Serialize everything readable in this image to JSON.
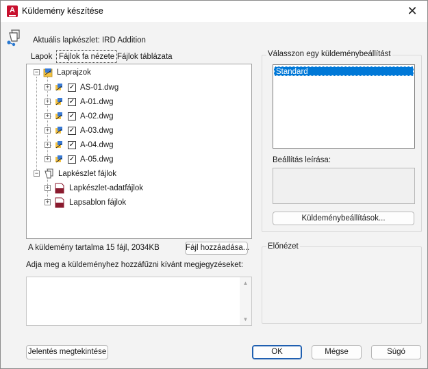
{
  "window": {
    "title": "Küldemény készítése",
    "close_glyph": "✕",
    "app_icon": "autocad-icon",
    "app_icon_letter": "A"
  },
  "current_sheet_set": "Aktuális lapkészlet: IRD Addition",
  "tabs": [
    {
      "label": "Lapok",
      "active": false
    },
    {
      "label": "Fájlok fa nézete",
      "active": true
    },
    {
      "label": "Fájlok táblázata",
      "active": false
    }
  ],
  "tree": {
    "root_drawings": {
      "label": "Laprajzok",
      "expander": "−",
      "icon": "drawings-folder-icon"
    },
    "drawings": [
      {
        "label": "AS-01.dwg",
        "checked": true,
        "expander": "+",
        "icon": "dwg-file-icon"
      },
      {
        "label": "A-01.dwg",
        "checked": true,
        "expander": "+",
        "icon": "dwg-file-icon"
      },
      {
        "label": "A-02.dwg",
        "checked": true,
        "expander": "+",
        "icon": "dwg-file-icon"
      },
      {
        "label": "A-03.dwg",
        "checked": true,
        "expander": "+",
        "icon": "dwg-file-icon"
      },
      {
        "label": "A-04.dwg",
        "checked": true,
        "expander": "+",
        "icon": "dwg-file-icon"
      },
      {
        "label": "A-05.dwg",
        "checked": true,
        "expander": "+",
        "icon": "dwg-file-icon"
      }
    ],
    "root_sheetset": {
      "label": "Lapkészlet fájlok",
      "expander": "−",
      "icon": "sheetset-file-icon"
    },
    "sheetset_files": [
      {
        "label": "Lapkészlet-adatfájlok",
        "expander": "+",
        "icon": "dst-file-icon",
        "badge": "DST"
      },
      {
        "label": "Lapsablon fájlok",
        "expander": "+",
        "icon": "dwt-file-icon",
        "badge": "DWT"
      }
    ],
    "check_glyph": "✓"
  },
  "summary": "A küldemény tartalma 15 fájl, 2034KB",
  "buttons": {
    "add_file": "Fájl hozzáadása...",
    "view_report": "Jelentés megtekintése",
    "ok": "OK",
    "cancel": "Mégse",
    "help": "Súgó",
    "transmittal_setups": "Küldeménybeállítások..."
  },
  "notes": {
    "label": "Adja meg a küldeményhez hozzáfűzni kívánt megjegyzéseket:",
    "value": "",
    "scroll_up": "▲",
    "scroll_down": "▼"
  },
  "setup_group": {
    "label": "Válasszon egy küldeménybeállítást",
    "items": [
      "Standard"
    ],
    "selected": "Standard",
    "description_label": "Beállítás leírása:",
    "description": ""
  },
  "preview_group": {
    "label": "Előnézet"
  },
  "colors": {
    "accent": "#0078d7",
    "app_red": "#c8102e",
    "default_button_border": "#1f5fb0"
  }
}
